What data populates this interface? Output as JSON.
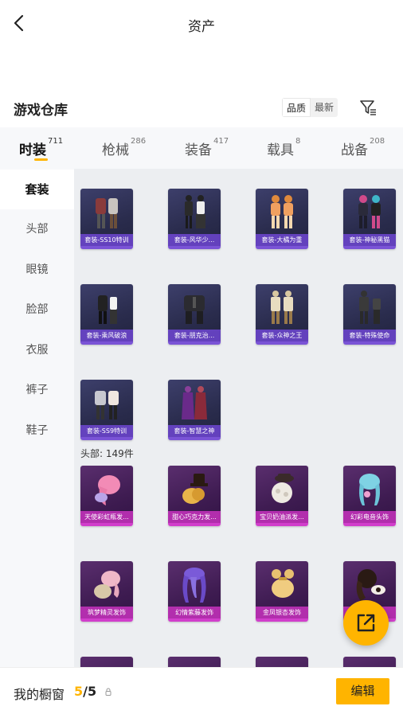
{
  "header": {
    "title": "资产"
  },
  "warehouse": {
    "title": "游戏仓库",
    "sort": [
      "品质",
      "最新"
    ]
  },
  "tabs": [
    {
      "label": "时装",
      "count": "711"
    },
    {
      "label": "枪械",
      "count": "286"
    },
    {
      "label": "装备",
      "count": "417"
    },
    {
      "label": "载具",
      "count": "8"
    },
    {
      "label": "战备",
      "count": "208"
    }
  ],
  "sidebar": [
    "套装",
    "头部",
    "眼镜",
    "脸部",
    "衣服",
    "裤子",
    "鞋子"
  ],
  "suits": [
    "套装-SS10特训",
    "套装-风华少...",
    "套装-大橘为重",
    "套装-神秘黑猫",
    "套装-乘风破浪",
    "套装-朋克治...",
    "套装-众神之王",
    "套装-特殊使命",
    "套装-SS9特训",
    "套装-智慧之神"
  ],
  "head_section": {
    "label": "头部: 149件"
  },
  "heads": [
    "天使彩虹瓶发...",
    "甜心巧克力发...",
    "宝贝奶油派发...",
    "幻彩电音头饰",
    "筑梦精灵发饰",
    "幻情紫藤发饰",
    "金凤银杏发饰",
    ""
  ],
  "bottom": {
    "label": "我的橱窗",
    "count_current": "5",
    "count_total": "/5",
    "edit": "编辑"
  },
  "colors": {
    "accent": "#ffb400",
    "suit_border": "#7a53d6",
    "head_border": "#d13ecb"
  }
}
